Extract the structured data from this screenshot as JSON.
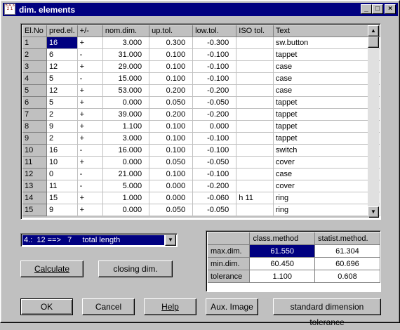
{
  "window": {
    "title": "dim. elements",
    "icon_text": "5 4 3 2 1",
    "minimize_glyph": "_",
    "maximize_glyph": "□",
    "close_glyph": "×"
  },
  "grid": {
    "columns": [
      "El.No",
      "pred.el.",
      "+/-",
      "nom.dim.",
      "up.tol.",
      "low.tol.",
      "ISO tol.",
      "Text"
    ],
    "rows": [
      [
        "1",
        "16",
        "+",
        "3.000",
        "0.300",
        "-0.300",
        "",
        "sw.button"
      ],
      [
        "2",
        "6",
        "-",
        "31.000",
        "0.100",
        "-0.100",
        "",
        "tappet"
      ],
      [
        "3",
        "12",
        "+",
        "29.000",
        "0.100",
        "-0.100",
        "",
        "case"
      ],
      [
        "4",
        "5",
        "-",
        "15.000",
        "0.100",
        "-0.100",
        "",
        "case"
      ],
      [
        "5",
        "12",
        "+",
        "53.000",
        "0.200",
        "-0.200",
        "",
        "case"
      ],
      [
        "6",
        "5",
        "+",
        "0.000",
        "0.050",
        "-0.050",
        "",
        "tappet"
      ],
      [
        "7",
        "2",
        "+",
        "39.000",
        "0.200",
        "-0.200",
        "",
        "tappet"
      ],
      [
        "8",
        "9",
        "+",
        "1.100",
        "0.100",
        "0.000",
        "",
        "tappet"
      ],
      [
        "9",
        "2",
        "+",
        "3.000",
        "0.100",
        "-0.100",
        "",
        "tappet"
      ],
      [
        "10",
        "16",
        "-",
        "16.000",
        "0.100",
        "-0.100",
        "",
        "switch"
      ],
      [
        "11",
        "10",
        "+",
        "0.000",
        "0.050",
        "-0.050",
        "",
        "cover"
      ],
      [
        "12",
        "0",
        "-",
        "21.000",
        "0.100",
        "-0.100",
        "",
        "case"
      ],
      [
        "13",
        "11",
        "-",
        "5.000",
        "0.000",
        "-0.200",
        "",
        "cover"
      ],
      [
        "14",
        "15",
        "+",
        "1.000",
        "0.000",
        "-0.060",
        "h 11",
        "ring"
      ],
      [
        "15",
        "9",
        "+",
        "0.000",
        "0.050",
        "-0.050",
        "",
        "ring"
      ]
    ],
    "scroll_up_glyph": "▲",
    "scroll_down_glyph": "▼"
  },
  "chain_select": {
    "value": "4.:  12 ==>   7     total length",
    "arrow_glyph": "▼"
  },
  "buttons": {
    "calculate": "Calculate",
    "closing_dim": "closing dim.",
    "ok": "OK",
    "cancel": "Cancel",
    "help": "Help",
    "aux_image": "Aux. Image",
    "standard_tolerance": "standard dimension tolerance"
  },
  "stats": {
    "columns": [
      "",
      "class.method",
      "statist.method."
    ],
    "rows": [
      {
        "label": "max.dim.",
        "class": "61.550",
        "statist": "61.304"
      },
      {
        "label": "min.dim.",
        "class": "60.450",
        "statist": "60.696"
      },
      {
        "label": "tolerance",
        "class": "1.100",
        "statist": "0.608"
      }
    ]
  }
}
